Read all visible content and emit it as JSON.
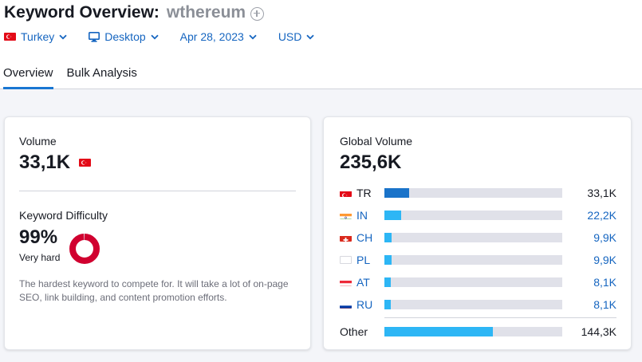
{
  "header": {
    "title": "Keyword Overview:",
    "keyword": "wthereum"
  },
  "filters": {
    "country": "Turkey",
    "device": "Desktop",
    "date": "Apr 28, 2023",
    "currency": "USD"
  },
  "tabs": [
    "Overview",
    "Bulk Analysis"
  ],
  "volume_card": {
    "volume_label": "Volume",
    "volume_value": "33,1K",
    "kd_label": "Keyword Difficulty",
    "kd_value": "99%",
    "kd_level": "Very hard",
    "kd_percent": 99,
    "description": "The hardest keyword to compete for. It will take a lot of on-page SEO, link building, and content promotion efforts."
  },
  "global_card": {
    "label": "Global Volume",
    "value": "235,6K",
    "countries": [
      {
        "code": "TR",
        "value": "33,1K",
        "share": 0.14
      },
      {
        "code": "IN",
        "value": "22,2K",
        "share": 0.094
      },
      {
        "code": "CH",
        "value": "9,9K",
        "share": 0.042
      },
      {
        "code": "PL",
        "value": "9,9K",
        "share": 0.042
      },
      {
        "code": "AT",
        "value": "8,1K",
        "share": 0.034
      },
      {
        "code": "RU",
        "value": "8,1K",
        "share": 0.034
      }
    ],
    "other": {
      "label": "Other",
      "value": "144,3K",
      "share": 0.612
    }
  },
  "colors": {
    "accent": "#1976d2",
    "link": "#1565c0",
    "bar_primary": "#1a73c9",
    "bar_secondary": "#2db6f5",
    "bar_track": "#e0e1e9",
    "kd_hard": "#d1002f"
  }
}
